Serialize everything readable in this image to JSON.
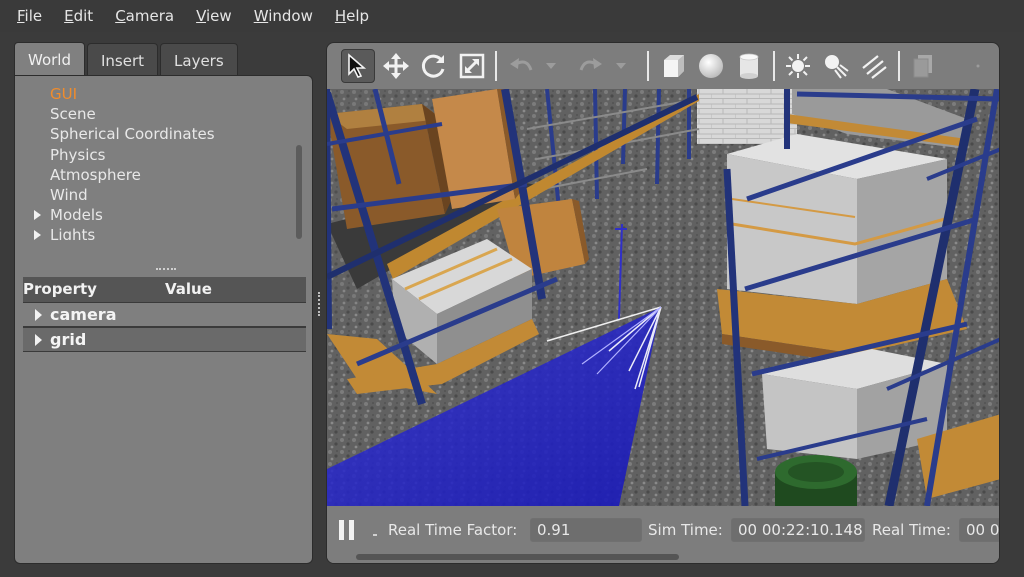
{
  "colors": {
    "accent": "#f08c2c",
    "panel": "#7f7f7f",
    "background": "#3b3b3b",
    "laser": "#2a2ad0"
  },
  "menu": {
    "items": [
      {
        "label": "File",
        "underline": "F",
        "rest": "ile"
      },
      {
        "label": "Edit",
        "underline": "E",
        "rest": "dit"
      },
      {
        "label": "Camera",
        "underline": "C",
        "rest": "amera"
      },
      {
        "label": "View",
        "underline": "V",
        "rest": "iew"
      },
      {
        "label": "Window",
        "underline": "W",
        "rest": "indow"
      },
      {
        "label": "Help",
        "underline": "H",
        "rest": "elp"
      }
    ]
  },
  "left_panel": {
    "tabs": [
      {
        "label": "World",
        "active": true
      },
      {
        "label": "Insert",
        "active": false
      },
      {
        "label": "Layers",
        "active": false
      }
    ],
    "tree": [
      {
        "label": "GUI",
        "selected": true,
        "expandable": false
      },
      {
        "label": "Scene",
        "selected": false,
        "expandable": false
      },
      {
        "label": "Spherical Coordinates",
        "selected": false,
        "expandable": false
      },
      {
        "label": "Physics",
        "selected": false,
        "expandable": false
      },
      {
        "label": "Atmosphere",
        "selected": false,
        "expandable": false
      },
      {
        "label": "Wind",
        "selected": false,
        "expandable": false
      },
      {
        "label": "Models",
        "selected": false,
        "expandable": true
      },
      {
        "label": "Lights",
        "selected": false,
        "expandable": true
      }
    ],
    "properties": {
      "col_property": "Property",
      "col_value": "Value",
      "rows": [
        {
          "label": "camera"
        },
        {
          "label": "grid"
        }
      ]
    }
  },
  "toolbar": {
    "icons": [
      "select-arrow-icon",
      "translate-icon",
      "rotate-icon",
      "scale-icon",
      "undo-icon",
      "undo-dropdown-icon",
      "redo-icon",
      "redo-dropdown-icon",
      "box-icon",
      "sphere-icon",
      "cylinder-icon",
      "point-light-icon",
      "spot-light-icon",
      "directional-light-icon",
      "copy-icon",
      "more-icon"
    ]
  },
  "statusbar": {
    "real_time_factor_label": "Real Time Factor:",
    "real_time_factor_value": "0.91",
    "sim_time_label": "Sim Time:",
    "sim_time_value": "00 00:22:10.148",
    "real_time_label": "Real Time:",
    "real_time_value": "00 0"
  }
}
